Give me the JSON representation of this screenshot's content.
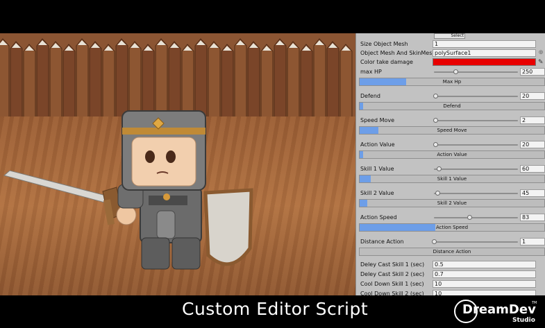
{
  "inspector": {
    "select_button": "Select",
    "size_object_mesh": {
      "label": "Size Object Mesh",
      "value": "1"
    },
    "object_mesh": {
      "label": "Object Mesh And SkinMes",
      "value": "polySurface1"
    },
    "color_take_damage": {
      "label": "Color take damage",
      "color": "#e80000"
    },
    "stats": [
      {
        "label": "max HP",
        "value": "250",
        "fraction": 0.26,
        "bar_label": "Max Hp",
        "bar_fill": 0.25
      },
      {
        "label": "Defend",
        "value": "20",
        "fraction": 0.02,
        "bar_label": "Defend",
        "bar_fill": 0.02
      },
      {
        "label": "Speed Move",
        "value": "2",
        "fraction": 0.02,
        "bar_label": "Speed Move",
        "bar_fill": 0.1
      },
      {
        "label": "Action Value",
        "value": "20",
        "fraction": 0.02,
        "bar_label": "Action Value",
        "bar_fill": 0.02
      },
      {
        "label": "Skill 1 Value",
        "value": "60",
        "fraction": 0.06,
        "bar_label": "Skill 1 Value",
        "bar_fill": 0.06
      },
      {
        "label": "Skill 2 Value",
        "value": "45",
        "fraction": 0.04,
        "bar_label": "Skill 2 Value",
        "bar_fill": 0.04
      },
      {
        "label": "Action Speed",
        "value": "83",
        "fraction": 0.42,
        "bar_label": "Action Speed",
        "bar_fill": 0.41
      },
      {
        "label": "Distance Action",
        "value": "1",
        "fraction": 0.0,
        "bar_label": "Distance Action",
        "bar_fill": 0.0
      }
    ],
    "fields": [
      {
        "label": "Deley Cast Skill 1 (sec)",
        "value": "0.5"
      },
      {
        "label": "Deley Cast Skill 2 (sec)",
        "value": "0.7"
      },
      {
        "label": "Cool Down Skill 1 (sec)",
        "value": "10"
      },
      {
        "label": "Cool Down Skill 2 (sec)",
        "value": "10"
      }
    ]
  },
  "caption": "Custom Editor Script",
  "logo": {
    "name": "DreamDev",
    "sub": "Studio",
    "tm": "TM"
  }
}
